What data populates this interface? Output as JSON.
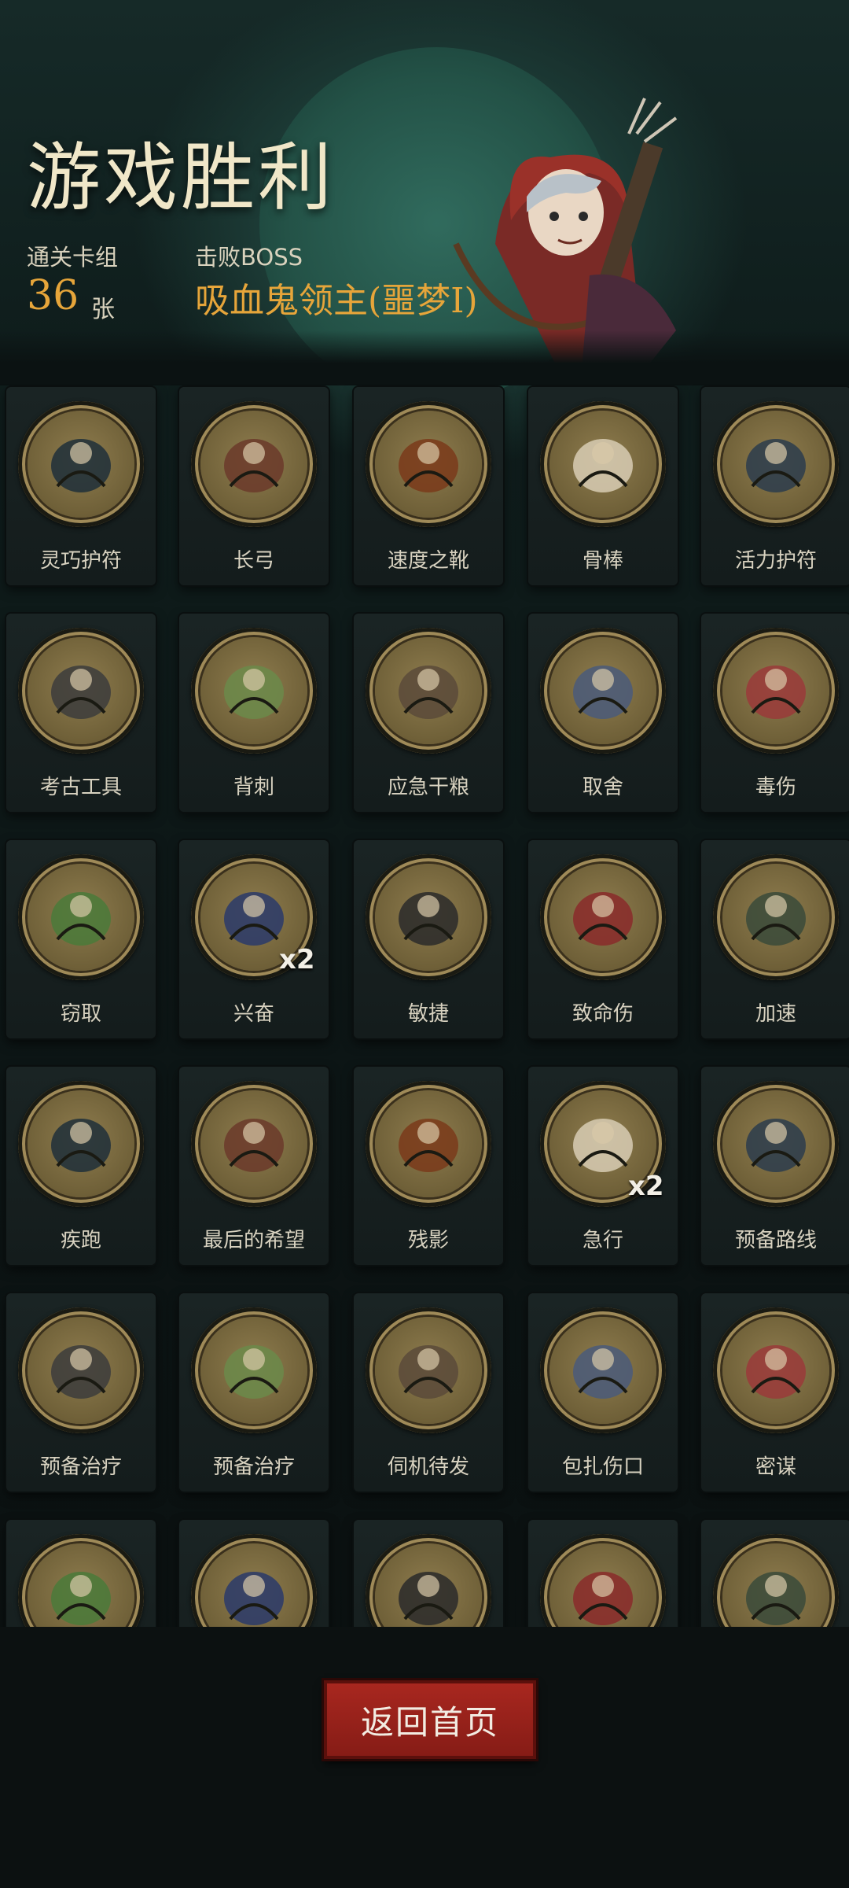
{
  "header": {
    "title": "游戏胜利",
    "deck_label": "通关卡组",
    "deck_count": "36",
    "deck_unit": "张",
    "boss_label": "击败BOSS",
    "boss_name": "吸血鬼领主(噩梦I)"
  },
  "cards": [
    {
      "name": "灵巧护符",
      "icon": "amulet-icon"
    },
    {
      "name": "长弓",
      "icon": "bow-icon"
    },
    {
      "name": "速度之靴",
      "icon": "boot-icon"
    },
    {
      "name": "骨棒",
      "icon": "bone-club-icon"
    },
    {
      "name": "活力护符",
      "icon": "amulet-icon"
    },
    {
      "name": "考古工具",
      "icon": "tools-icon"
    },
    {
      "name": "背刺",
      "icon": "backstab-icon"
    },
    {
      "name": "应急干粮",
      "icon": "rations-icon"
    },
    {
      "name": "取舍",
      "icon": "sage-icon"
    },
    {
      "name": "毒伤",
      "icon": "poison-icon"
    },
    {
      "name": "窃取",
      "icon": "goblin-icon"
    },
    {
      "name": "兴奋",
      "icon": "excite-icon",
      "count": "x2"
    },
    {
      "name": "敏捷",
      "icon": "cat-icon"
    },
    {
      "name": "致命伤",
      "icon": "wound-icon"
    },
    {
      "name": "加速",
      "icon": "witch-icon"
    },
    {
      "name": "疾跑",
      "icon": "sprint-icon"
    },
    {
      "name": "最后的希望",
      "icon": "girl-icon"
    },
    {
      "name": "残影",
      "icon": "afterimage-icon"
    },
    {
      "name": "急行",
      "icon": "dash-icon",
      "count": "x2"
    },
    {
      "name": "预备路线",
      "icon": "map-icon"
    },
    {
      "name": "预备治疗",
      "icon": "heart-icon"
    },
    {
      "name": "预备治疗",
      "icon": "heart-icon"
    },
    {
      "name": "伺机待发",
      "icon": "ninja-icon"
    },
    {
      "name": "包扎伤口",
      "icon": "plague-doctor-icon"
    },
    {
      "name": "密谋",
      "icon": "hooded-icon"
    },
    {
      "name": "",
      "icon": "bird-icon"
    },
    {
      "name": "",
      "icon": "fighter-icon"
    },
    {
      "name": "",
      "icon": "group-icon"
    },
    {
      "name": "",
      "icon": "detective-icon"
    },
    {
      "name": "",
      "icon": "scholar-icon"
    }
  ],
  "footer": {
    "return_label": "返回首页"
  },
  "colors": {
    "accent": "#e6a53a",
    "button": "#a8271f",
    "medal": "#7a6a42"
  }
}
